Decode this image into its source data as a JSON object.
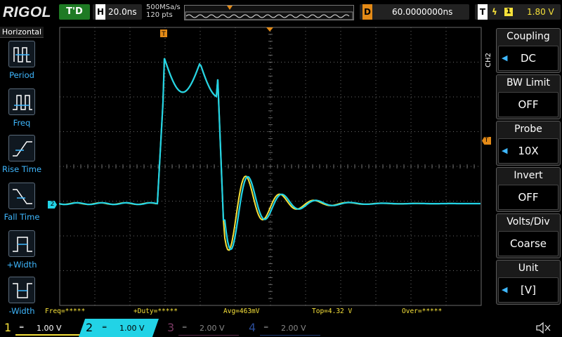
{
  "top": {
    "logo": "RIGOL",
    "run_state": "T'D",
    "horizontal": {
      "key": "H",
      "value": "20.0ns"
    },
    "sample_rate": "500MSa/s",
    "memory_depth": "120 pts",
    "delay": {
      "key": "D",
      "value": "60.0000000ns"
    },
    "trigger": {
      "key": "T",
      "edge": "ϟ",
      "source": "1",
      "level": "1.80 V"
    }
  },
  "left_panel": {
    "title": "Horizontal",
    "items": [
      {
        "label": "Period",
        "icon": "period-icon"
      },
      {
        "label": "Freq",
        "icon": "freq-icon"
      },
      {
        "label": "Rise Time",
        "icon": "rise-time-icon"
      },
      {
        "label": "Fall Time",
        "icon": "fall-time-icon"
      },
      {
        "label": "+Width",
        "icon": "positive-width-icon"
      },
      {
        "label": "-Width",
        "icon": "negative-width-icon"
      }
    ]
  },
  "right_panel": {
    "channel_tab": "CH2",
    "items": [
      {
        "title": "Coupling",
        "value": "DC"
      },
      {
        "title": "BW Limit",
        "value": "OFF"
      },
      {
        "title": "Probe",
        "value": "10X"
      },
      {
        "title": "Invert",
        "value": "OFF"
      },
      {
        "title": "Volts/Div",
        "value": "Coarse"
      },
      {
        "title": "Unit",
        "value": "[V]"
      }
    ]
  },
  "measurements": {
    "freq": "Freq=*****",
    "duty": "+Duty=*****",
    "avg": "Avg=463mV",
    "top": "Top=4.32 V",
    "over": "Over=*****"
  },
  "markers": {
    "trigger_position": "T",
    "trigger_level": "T",
    "ch2_ground": "2"
  },
  "channels": [
    {
      "num": "1",
      "coupling": "═",
      "scale": "1.00 V",
      "color": "#f6e13a",
      "active": true
    },
    {
      "num": "2",
      "coupling": "═",
      "scale": "1.00 V",
      "color": "#22d3e6",
      "active": true
    },
    {
      "num": "3",
      "coupling": "═",
      "scale": "2.00 V",
      "color": "#c0468e",
      "active": false
    },
    {
      "num": "4",
      "coupling": "═",
      "scale": "2.00 V",
      "color": "#2a6cd6",
      "active": false
    }
  ],
  "colors": {
    "ch1": "#f6e13a",
    "ch2": "#22d3e6",
    "accent": "#3fb8ff",
    "trigger": "#e38a17",
    "grid": "#6a6a6a"
  }
}
